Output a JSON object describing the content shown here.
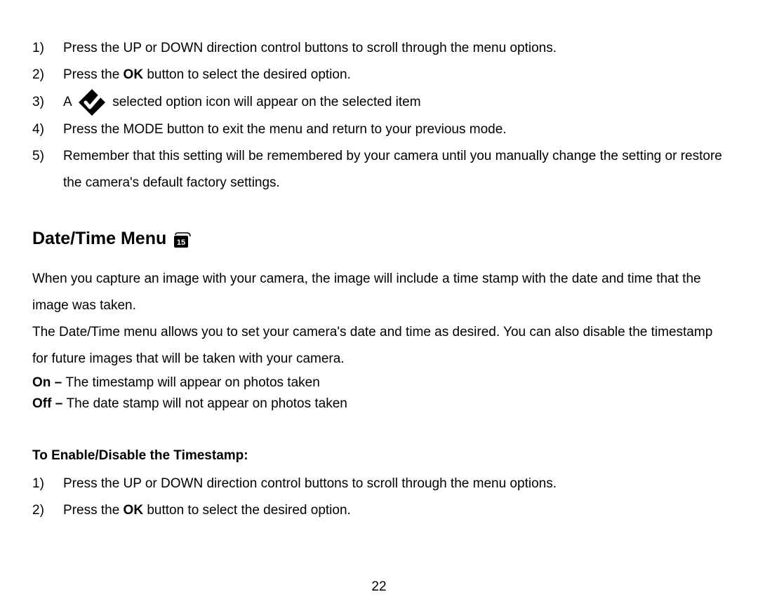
{
  "list1": {
    "items": [
      {
        "num": "1)",
        "text": "Press the UP or DOWN direction control buttons to scroll through the menu options."
      },
      {
        "num": "2)",
        "pre": "Press the ",
        "bold": "OK",
        "post": " button to select the desired option."
      },
      {
        "num": "3)",
        "pre": "A ",
        "post": "selected option icon will appear on the selected item",
        "icon": true
      },
      {
        "num": "4)",
        "text": "Press the MODE button to exit the menu and return to your previous mode."
      },
      {
        "num": "5)",
        "text": "Remember that this setting will be remembered by your camera until you manually change the setting or restore the camera's default factory settings."
      }
    ]
  },
  "heading": "Date/Time Menu",
  "para1": "When you capture an image with your camera, the image will include a time stamp with the date and time that the image was taken.",
  "para2": "The Date/Time menu allows you to set your camera's date and time as desired. You can also disable the timestamp for future images that will be taken with your camera.",
  "opt_on_bold": "On – ",
  "opt_on_rest": "The timestamp will appear on photos taken",
  "opt_off_bold": "Off – ",
  "opt_off_rest": "The date stamp will not appear on photos taken",
  "subheading": "To Enable/Disable the Timestamp:",
  "list2": {
    "items": [
      {
        "num": "1)",
        "text": "Press the UP or DOWN direction control buttons to scroll through the menu options."
      },
      {
        "num": "2)",
        "pre": "Press the ",
        "bold": "OK",
        "post": " button to select the desired option."
      }
    ]
  },
  "page_number": "22"
}
